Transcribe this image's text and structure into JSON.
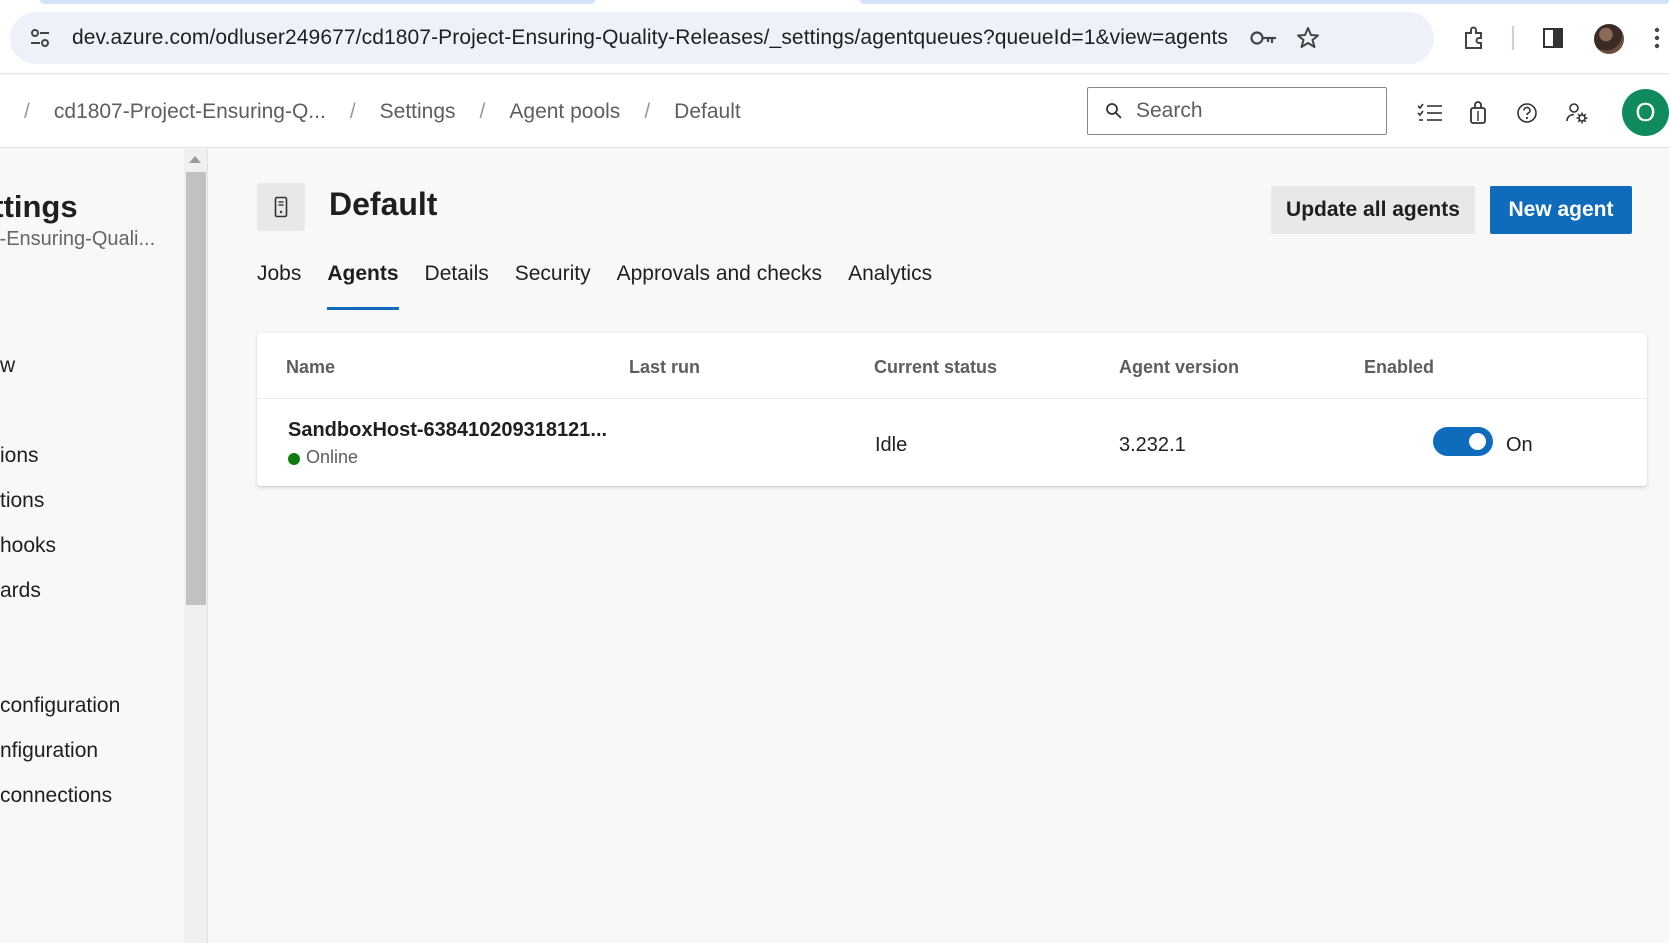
{
  "browser": {
    "url": "dev.azure.com/odluser249677/cd1807-Project-Ensuring-Quality-Releases/_settings/agentqueues?queueId=1&view=agents"
  },
  "breadcrumbs": [
    {
      "label": "cd1807-Project-Ensuring-Q..."
    },
    {
      "label": "Settings"
    },
    {
      "label": "Agent pools"
    },
    {
      "label": "Default"
    }
  ],
  "search": {
    "placeholder": "Search"
  },
  "user": {
    "initial": "O",
    "avatar_color": "#0f8b5e"
  },
  "sidebar": {
    "title": "ettings",
    "subtitle": "ct-Ensuring-Quali...",
    "items": [
      {
        "label": "w"
      },
      {
        "label": "ions"
      },
      {
        "label": "tions"
      },
      {
        "label": "hooks"
      },
      {
        "label": "ards"
      },
      {
        "label": "configuration"
      },
      {
        "label": "nfiguration"
      },
      {
        "label": "connections"
      }
    ]
  },
  "pool": {
    "title": "Default",
    "update_button": "Update all agents",
    "new_button": "New agent"
  },
  "tabs": [
    {
      "label": "Jobs",
      "active": false
    },
    {
      "label": "Agents",
      "active": true
    },
    {
      "label": "Details",
      "active": false
    },
    {
      "label": "Security",
      "active": false
    },
    {
      "label": "Approvals and checks",
      "active": false
    },
    {
      "label": "Analytics",
      "active": false
    }
  ],
  "grid": {
    "columns": [
      "Name",
      "Last run",
      "Current status",
      "Agent version",
      "Enabled"
    ],
    "rows": [
      {
        "name": "SandboxHost-638410209318121...",
        "connection": "Online",
        "last_run": "",
        "status": "Idle",
        "version": "3.232.1",
        "enabled": true,
        "enabled_label": "On"
      }
    ]
  },
  "colors": {
    "accent": "#0f6cbd",
    "online": "#107c10"
  }
}
